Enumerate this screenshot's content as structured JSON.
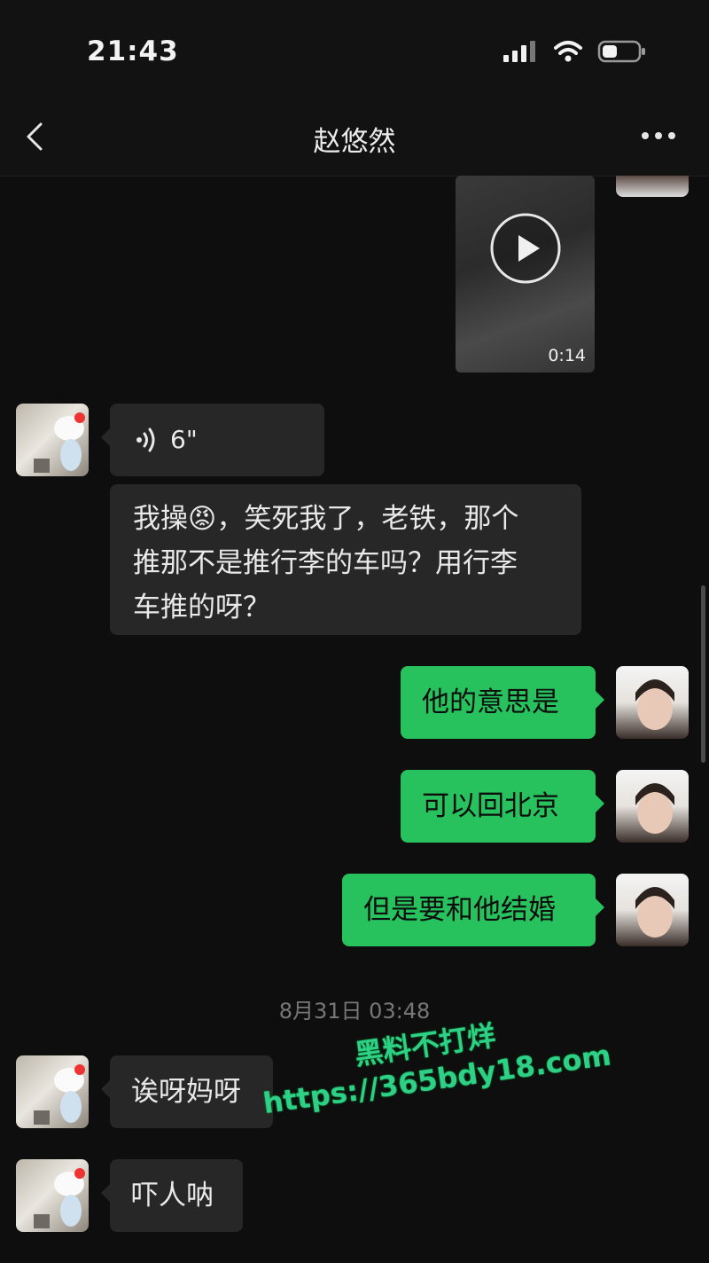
{
  "status": {
    "time": "21:43"
  },
  "header": {
    "title": "赵悠然"
  },
  "messages": {
    "video_duration": "0:14",
    "voice_duration": "6\"",
    "text1": [
      "我操😡，笑死我了，老铁，那个",
      "推那不是推行李的车吗？用行李",
      "车推的呀？"
    ],
    "out1": "他的意思是",
    "out2": "可以回北京",
    "out3": "但是要和他结婚",
    "timestamp": "8月31日 03:48",
    "in2": "诶呀妈呀",
    "in3": "吓人呐"
  },
  "watermark": {
    "line1": "黑料不打烊",
    "line2": "https://365bdy18.com"
  },
  "colors": {
    "sent_bubble": "#27c15e",
    "received_bubble": "#272727",
    "background": "#0e0e0e"
  },
  "icons": [
    "back-icon",
    "more-icon",
    "signal-icon",
    "wifi-icon",
    "battery-icon",
    "play-icon",
    "voice-icon"
  ]
}
